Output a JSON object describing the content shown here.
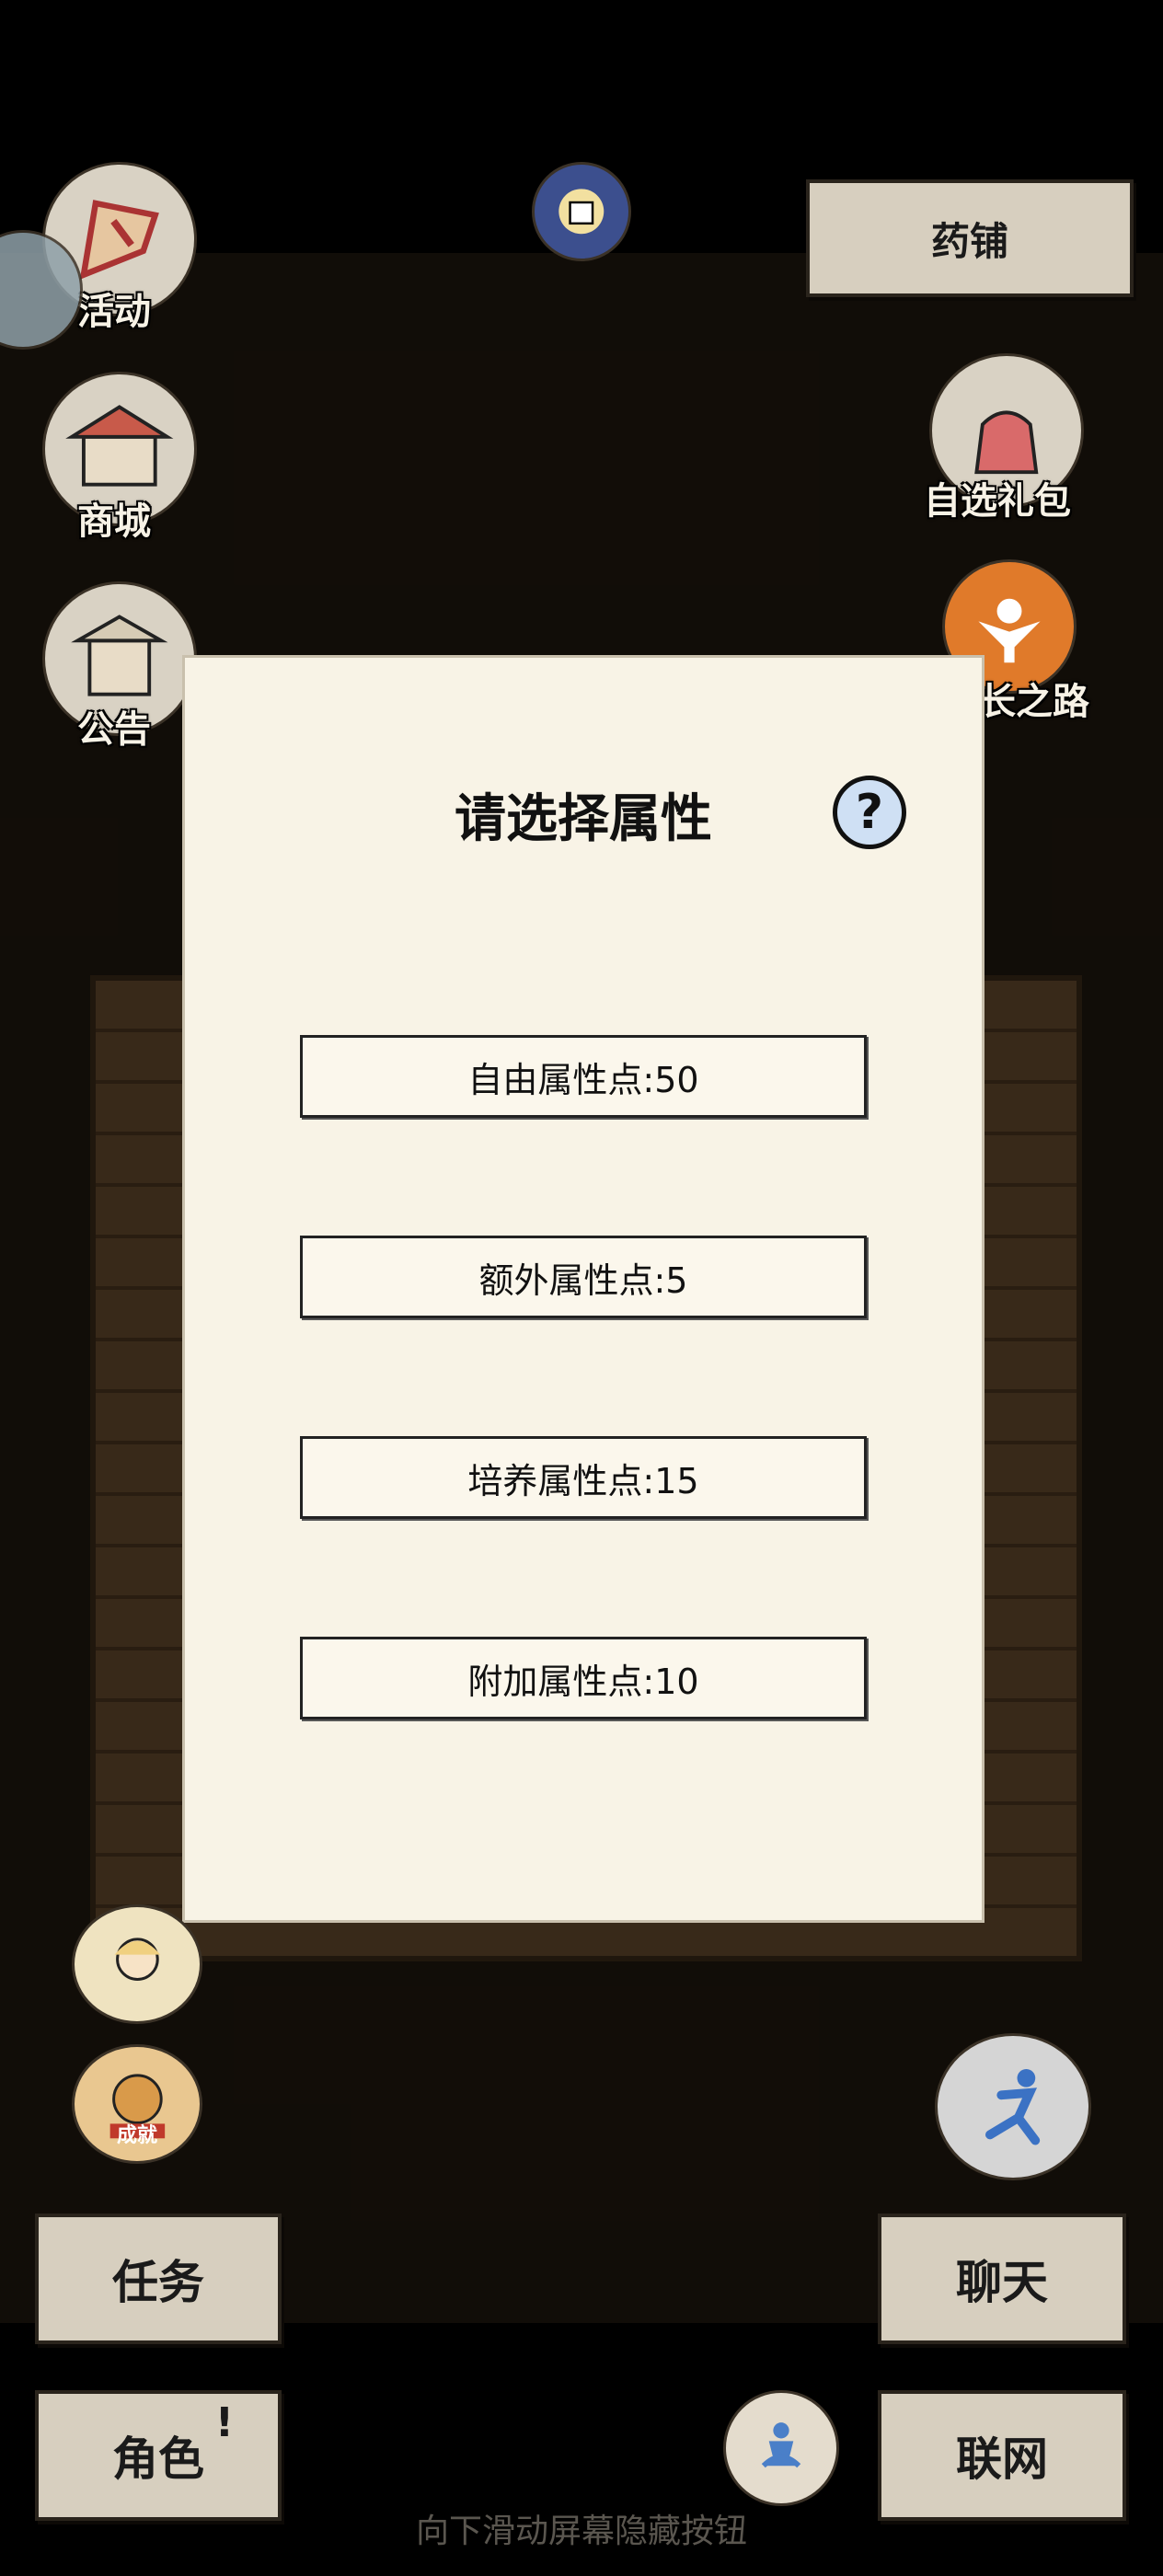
{
  "top": {
    "shop_label": "药铺"
  },
  "left_buttons": [
    {
      "label": "活动",
      "icon": "flag-icon"
    },
    {
      "label": "商城",
      "icon": "store-icon"
    },
    {
      "label": "公告",
      "icon": "notice-board-icon"
    }
  ],
  "right_buttons": [
    {
      "label": "自选礼包",
      "icon": "gift-bag-icon"
    },
    {
      "label": "长之路",
      "icon": "growth-path-icon"
    }
  ],
  "modal": {
    "title": "请选择属性",
    "help": "?",
    "attributes": [
      {
        "label": "自由属性点:50"
      },
      {
        "label": "额外属性点:5"
      },
      {
        "label": "培养属性点:15"
      },
      {
        "label": "附加属性点:10"
      }
    ]
  },
  "achievement_badge": "成就",
  "bottom": {
    "task": "任务",
    "role": "角色",
    "role_alert": "!",
    "chat": "聊天",
    "network": "联网"
  },
  "gesture_hint": "向下滑动屏幕隐藏按钮",
  "colors": {
    "modal_bg": "#f8f3e6",
    "button_bg": "#d7cfbf",
    "scene_bg": "#1b140d"
  }
}
